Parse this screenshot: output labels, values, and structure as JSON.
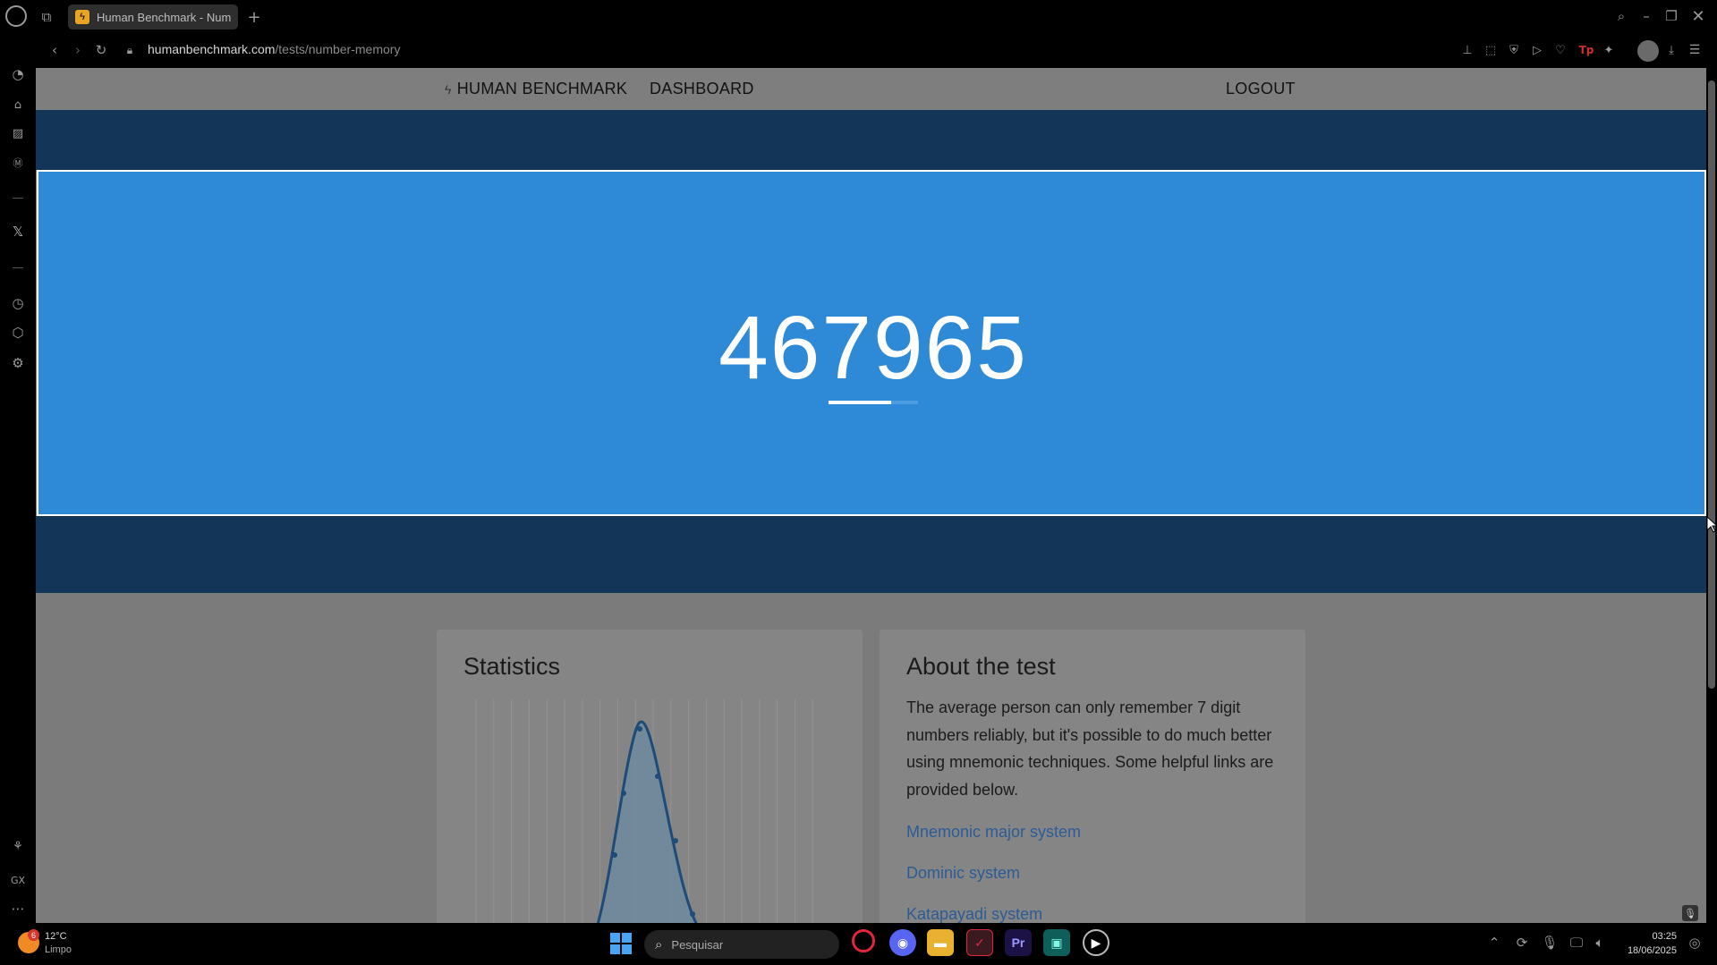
{
  "browser": {
    "tab_title": "Human Benchmark - Num",
    "new_tab": "+",
    "url_host": "humanbenchmark.com",
    "url_path": "/tests/number-memory"
  },
  "nav": {
    "brand": "HUMAN BENCHMARK",
    "dashboard": "DASHBOARD",
    "logout": "LOGOUT"
  },
  "test": {
    "number": "467965",
    "timer_remaining": 0.7
  },
  "statistics": {
    "title": "Statistics"
  },
  "about": {
    "title": "About the test",
    "text": "The average person can only remember 7 digit numbers reliably, but it's possible to do much better using mnemonic techniques. Some helpful links are provided below.",
    "links": [
      "Mnemonic major system",
      "Dominic system",
      "Katapayadi system"
    ]
  },
  "taskbar": {
    "temperature": "12°C",
    "weather": "Limpo",
    "weather_badge": "6",
    "search_placeholder": "Pesquisar",
    "time": "03:25",
    "date": "18/06/2025"
  },
  "colors": {
    "test_blue": "#2e8ad6",
    "band_navy": "#123558"
  }
}
